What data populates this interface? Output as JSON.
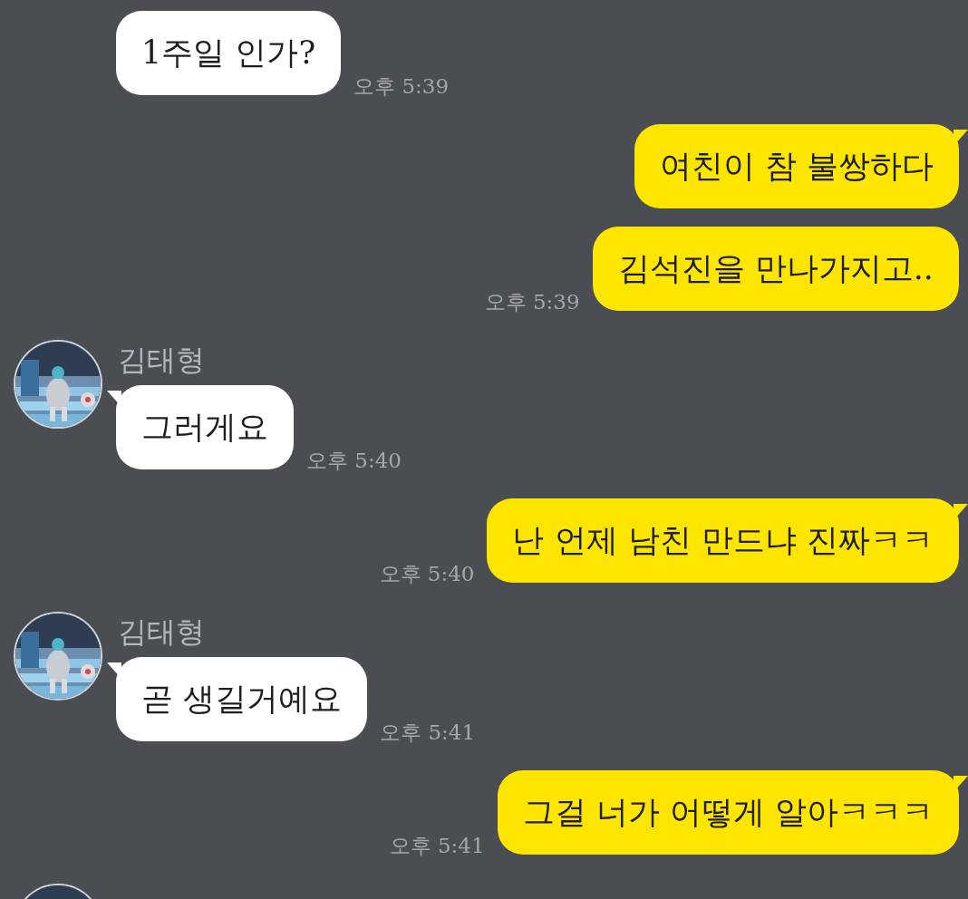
{
  "messages": [
    {
      "kind": "incoming",
      "text": "1주일 인가?",
      "time": "오후 5:39",
      "tail": false
    },
    {
      "kind": "outgoing",
      "text": "여친이 참 불쌍하다",
      "tail": true
    },
    {
      "kind": "outgoing",
      "text": "김석진을 만나가지고..",
      "time": "오후 5:39",
      "tail": false
    },
    {
      "kind": "incoming",
      "avatar": true,
      "sender": "김태형",
      "text": "그러게요",
      "time": "오후 5:40",
      "tail": true
    },
    {
      "kind": "outgoing",
      "text": "난 언제 남친 만드냐 진짜ㅋㅋ",
      "time": "오후 5:40",
      "tail": true
    },
    {
      "kind": "incoming",
      "avatar": true,
      "sender": "김태형",
      "text": "곧 생길거예요",
      "time": "오후 5:41",
      "tail": true
    },
    {
      "kind": "outgoing",
      "text": "그걸 너가 어떻게 알아ㅋㅋㅋ",
      "time": "오후 5:41",
      "tail": true
    },
    {
      "kind": "incoming",
      "avatar": true
    }
  ]
}
